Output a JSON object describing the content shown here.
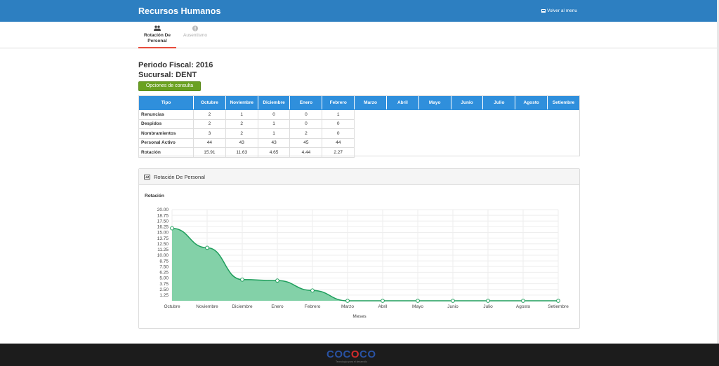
{
  "header": {
    "title": "Recursos Humanos",
    "back_label": "Volver al menu"
  },
  "tabs": [
    {
      "line1": "Rotación De",
      "line2": "Personal",
      "icon": "users-icon",
      "active": true
    },
    {
      "line1": "Ausentismo",
      "line2": "",
      "icon": "alert-icon",
      "active": false
    }
  ],
  "info": {
    "fiscal": "Periodo Fiscal: 2016",
    "sucursal": "Sucursal: DENT",
    "options_button": "Opciones de consulta"
  },
  "table": {
    "columns": [
      "Tipo",
      "Octubre",
      "Noviembre",
      "Diciembre",
      "Enero",
      "Febrero",
      "Marzo",
      "Abril",
      "Mayo",
      "Junio",
      "Julio",
      "Agosto",
      "Setiembre"
    ],
    "rows": [
      [
        "Renuncias",
        "2",
        "1",
        "0",
        "0",
        "1"
      ],
      [
        "Despidos",
        "2",
        "2",
        "1",
        "0",
        "0"
      ],
      [
        "Nombramientos",
        "3",
        "2",
        "1",
        "2",
        "0"
      ],
      [
        "Personal Activo",
        "44",
        "43",
        "43",
        "45",
        "44"
      ],
      [
        "Rotación",
        "15.91",
        "11.63",
        "4.65",
        "4.44",
        "2.27"
      ]
    ]
  },
  "panel": {
    "title": "Rotación De Personal"
  },
  "chart_data": {
    "type": "area",
    "title": "Rotación",
    "xlabel": "Meses",
    "ylabel": "",
    "categories": [
      "Octubre",
      "Noviembre",
      "Diciembre",
      "Enero",
      "Febrero",
      "Marzo",
      "Abril",
      "Mayo",
      "Junio",
      "Julio",
      "Agosto",
      "Setiembre"
    ],
    "series": [
      {
        "name": "",
        "values": [
          15.91,
          11.63,
          4.65,
          4.44,
          2.27,
          0,
          0,
          0,
          0,
          0,
          0,
          0
        ]
      }
    ],
    "yticks": [
      "1.25",
      "2.50",
      "3.75",
      "5.00",
      "6.25",
      "7.50",
      "8.75",
      "10.00",
      "11.25",
      "12.50",
      "13.75",
      "15.00",
      "16.25",
      "17.50",
      "18.75",
      "20.00"
    ],
    "ylim": [
      0,
      20
    ],
    "grid": true,
    "colors": {
      "fill": "#7ccfa3",
      "line": "#1f9e5c"
    }
  },
  "footer": {
    "logo_a": "COC",
    "logo_o": "O",
    "logo_b": "CO",
    "tagline": "Tecnología para el desarrollo"
  }
}
